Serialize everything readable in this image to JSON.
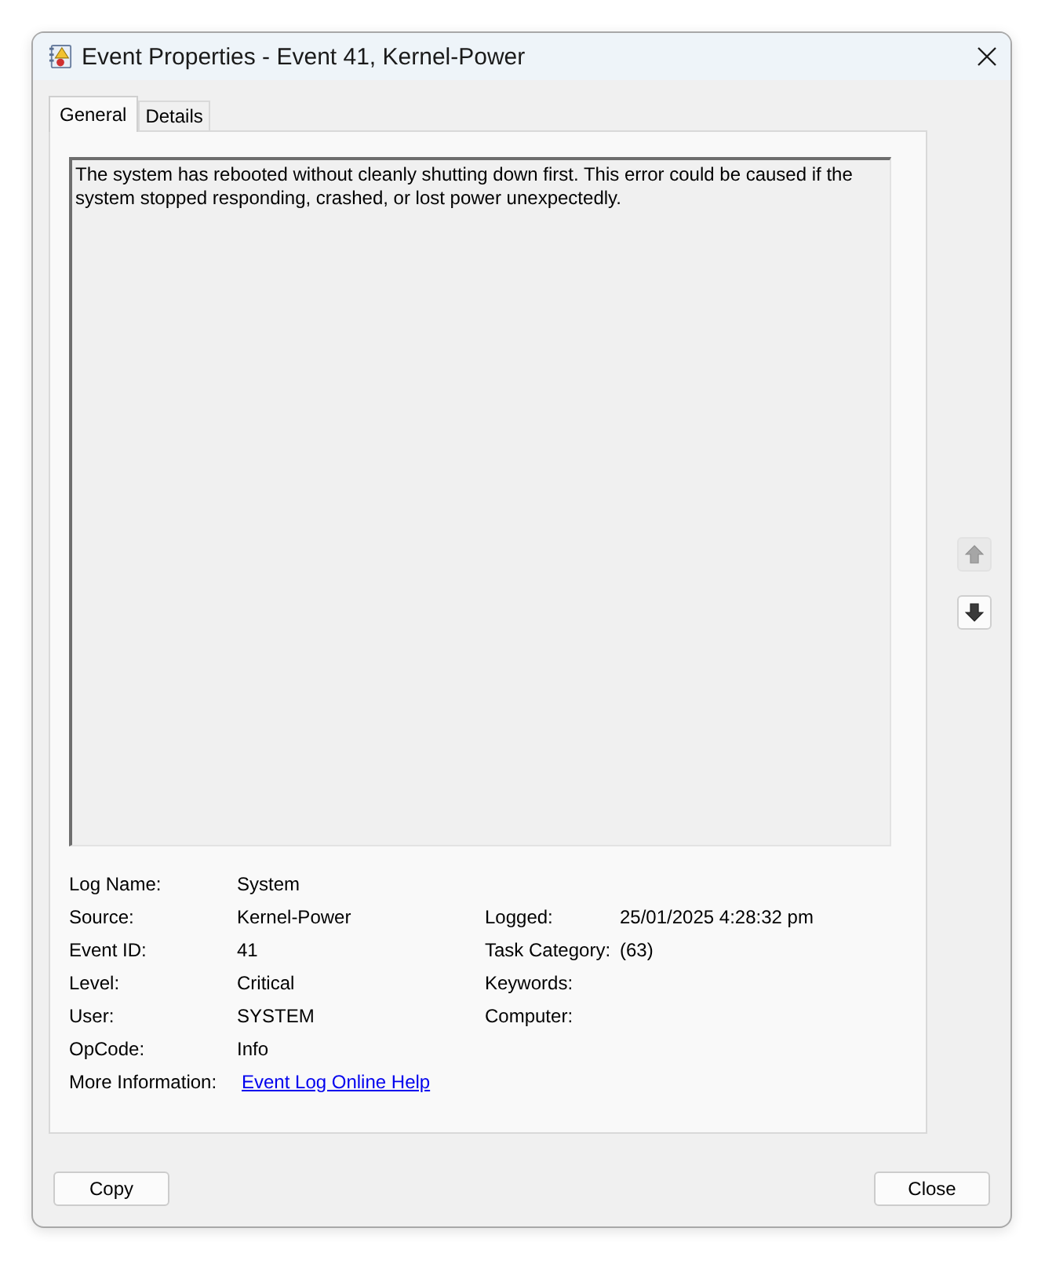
{
  "window": {
    "title": "Event Properties - Event 41, Kernel-Power"
  },
  "tabs": [
    {
      "label": "General",
      "selected": true
    },
    {
      "label": "Details",
      "selected": false
    }
  ],
  "description": "The system has rebooted without cleanly shutting down first. This error could be caused if the system stopped responding, crashed, or lost power unexpectedly.",
  "navigation": [
    {
      "kind": "up",
      "disabled": true
    },
    {
      "kind": "down",
      "disabled": false
    }
  ],
  "left_fields": [
    {
      "kind": "text",
      "label": "Log Name:",
      "value": "System"
    },
    {
      "kind": "text",
      "label": "Source:",
      "value": "Kernel-Power"
    },
    {
      "kind": "text",
      "label": "Event ID:",
      "value": "41"
    },
    {
      "kind": "text",
      "label": "Level:",
      "value": "Critical"
    },
    {
      "kind": "text",
      "label": "User:",
      "value": "SYSTEM"
    },
    {
      "kind": "text",
      "label": "OpCode:",
      "value": "Info"
    },
    {
      "kind": "link",
      "label": "More Information:",
      "value": "Event Log Online Help"
    }
  ],
  "right_fields": [
    {
      "label": "Logged:",
      "value": "25/01/2025 4:28:32 pm"
    },
    {
      "label": "Task Category:",
      "value": "(63)"
    },
    {
      "label": "Keywords:"
    },
    {
      "label": "Computer:"
    }
  ],
  "buttons": [
    {
      "label": "Copy"
    },
    {
      "label": "Close"
    }
  ]
}
